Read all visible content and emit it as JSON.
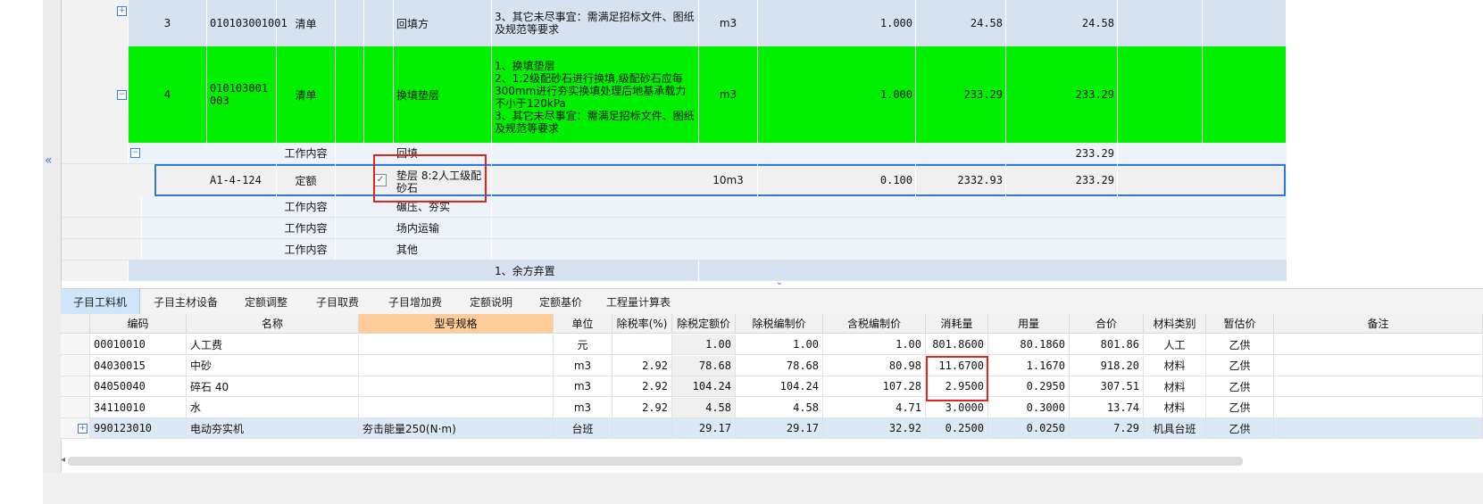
{
  "tree": {
    "rows": [
      {
        "no": "3",
        "code": "010103001001",
        "type": "清单",
        "name": "回填方",
        "desc": "3、其它未尽事宜：需满足招标文件、图纸及规范等要求",
        "unit": "m3",
        "qty": "1.000",
        "price": "24.58",
        "total": "24.58"
      },
      {
        "no": "4",
        "code": "010103001003",
        "type": "清单",
        "name": "换填垫层",
        "desc": "1、换填垫层\n2、1:2级配砂石进行换填,级配砂石应每300mm进行夯实换填处理后地基承载力不小于120kPa\n3、其它未尽事宜：需满足招标文件、图纸及规范等要求",
        "unit": "m3",
        "qty": "1.000",
        "price": "233.29",
        "total": "233.29"
      },
      {
        "type": "工作内容",
        "name": "回填",
        "total": "233.29"
      },
      {
        "code": "A1-4-124",
        "type": "定额",
        "name": "垫层 8:2人工级配砂石",
        "unit": "10m3",
        "qty": "0.100",
        "price": "2332.93",
        "total": "233.29"
      },
      {
        "type": "工作内容",
        "name": "碾压、夯实"
      },
      {
        "type": "工作内容",
        "name": "场内运输"
      },
      {
        "type": "工作内容",
        "name": "其他"
      },
      {
        "desc": "1、余方弃置"
      }
    ]
  },
  "tabs": [
    "子目工料机",
    "子目主材设备",
    "定额调整",
    "子目取费",
    "子目增加费",
    "定额说明",
    "定额基价",
    "工程量计算表"
  ],
  "grid": {
    "headers": [
      "编码",
      "名称",
      "型号规格",
      "单位",
      "除税率(%)",
      "除税定额价",
      "除税编制价",
      "含税编制价",
      "消耗量",
      "用量",
      "合价",
      "材料类别",
      "暂估价",
      "备注"
    ],
    "rows": [
      [
        "00010010",
        "人工费",
        "",
        "元",
        "",
        "1.00",
        "1.00",
        "1.00",
        "801.8600",
        "80.1860",
        "801.86",
        "人工",
        "乙供",
        ""
      ],
      [
        "04030015",
        "中砂",
        "",
        "m3",
        "2.92",
        "78.68",
        "78.68",
        "80.98",
        "11.6700",
        "1.1670",
        "918.20",
        "材料",
        "乙供",
        ""
      ],
      [
        "04050040",
        "碎石 40",
        "",
        "m3",
        "2.92",
        "104.24",
        "104.24",
        "107.28",
        "2.9500",
        "0.2950",
        "307.51",
        "材料",
        "乙供",
        ""
      ],
      [
        "34110010",
        "水",
        "",
        "m3",
        "2.92",
        "4.58",
        "4.58",
        "4.71",
        "3.0000",
        "0.3000",
        "13.74",
        "材料",
        "乙供",
        ""
      ],
      [
        "990123010",
        "电动夯实机",
        "夯击能量250(N·m)",
        "台班",
        "",
        "29.17",
        "29.17",
        "32.92",
        "0.2500",
        "0.0250",
        "7.29",
        "机具台班",
        "乙供",
        ""
      ]
    ]
  },
  "colors": {
    "green": "#00f000",
    "lightblue": "#d6e2f0",
    "selected": "#2f7ad8",
    "red": "#e2241b",
    "orange": "#fdcc99"
  },
  "icons": {
    "expand": "plus-icon",
    "collapse": "minus-icon",
    "checkbox": "checked-checkbox-icon"
  }
}
